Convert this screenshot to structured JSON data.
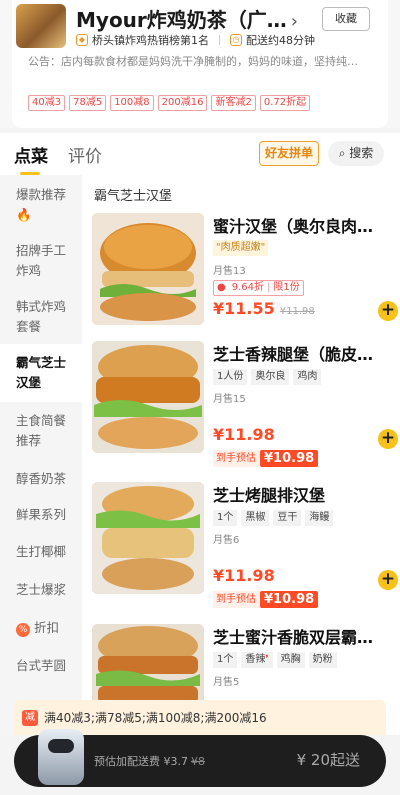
{
  "store": {
    "name": "Myour炸鸡奶茶（广…",
    "chevron": "›",
    "favorite_label": "收藏",
    "ranking": "桥头镇炸鸡热销榜第1名",
    "eta": "配送约48分钟",
    "notice": "公告：店内每款食材都是妈妈洗干净腌制的，妈妈的味道，坚持纯…",
    "promos": [
      "40减3",
      "78减5",
      "100减8",
      "200减16",
      "新客减2",
      "0.72折起"
    ]
  },
  "tabs": {
    "order": "点菜",
    "review": "评价",
    "group": "好友拼单",
    "search": "搜索"
  },
  "sidebar": {
    "items": [
      {
        "label": "爆款推荐",
        "emoji": "🔥"
      },
      {
        "label": "招牌手工炸鸡"
      },
      {
        "label": "韩式炸鸡套餐"
      },
      {
        "label": "霸气芝士汉堡"
      },
      {
        "label": "主食简餐推荐"
      },
      {
        "label": "醇香奶茶"
      },
      {
        "label": "鲜果系列"
      },
      {
        "label": "生打椰椰"
      },
      {
        "label": "芝士爆浆"
      },
      {
        "label": "折扣"
      },
      {
        "label": "台式芋圆"
      }
    ]
  },
  "menu": {
    "category": "霸气芝士汉堡",
    "items": [
      {
        "name": "蜜汁汉堡（奥尔良肉…",
        "tag": "\"肉质超嫩\"",
        "sold": "月售13",
        "discount": "9.64折",
        "limit": "限1份",
        "price": "¥11.55",
        "orig_price": "¥11.98"
      },
      {
        "name": "芝士香辣腿堡（脆皮…",
        "chips": [
          "1人份",
          "奥尔良",
          "鸡肉"
        ],
        "sold": "月售15",
        "price": "¥11.98",
        "est_label": "到手预估",
        "est_price": "¥10.98"
      },
      {
        "name": "芝士烤腿排汉堡",
        "chips": [
          "1个",
          "黑椒",
          "豆干",
          "海鳗"
        ],
        "sold": "月售6",
        "price": "¥11.98",
        "est_label": "到手预估",
        "est_price": "¥10.98"
      },
      {
        "name": "芝士蜜汁香脆双层霸…",
        "chips": [
          "1个",
          "香辣",
          "鸡胸",
          "奶粉"
        ],
        "sold": "月售5"
      }
    ]
  },
  "promo_bar": {
    "icon": "减",
    "text": "满40减3;满78减5;满100减8;满200减16"
  },
  "cart": {
    "fee_label": "预估加配送费 ¥3.7",
    "fee_orig": "¥8",
    "start_label": "¥ 20起送"
  },
  "colors": {
    "accent": "#f6c21a",
    "price": "#ff4a26"
  }
}
